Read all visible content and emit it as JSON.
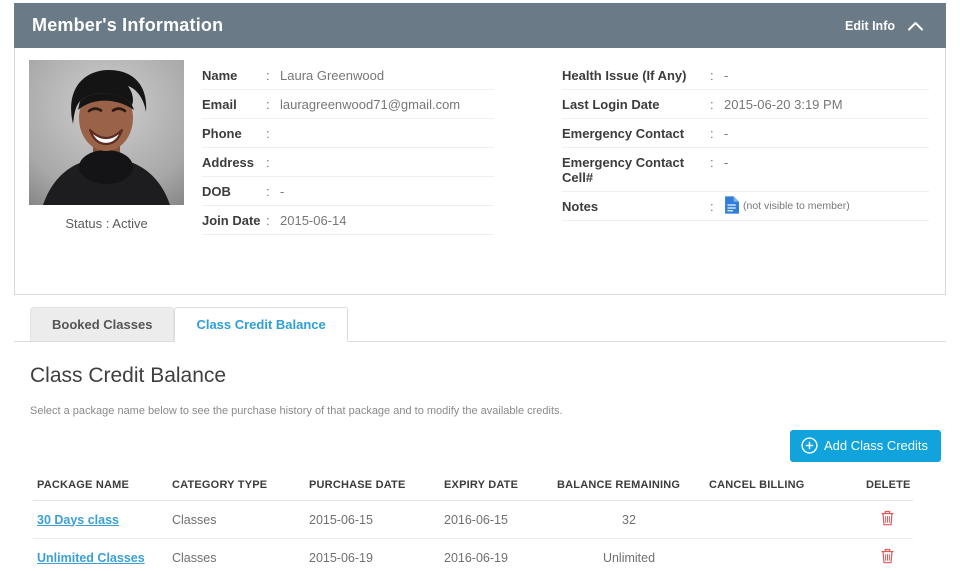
{
  "ui": {
    "colon": ":"
  },
  "colors": {
    "header_bg": "#6a7a86",
    "accent_blue": "#10a3dc",
    "link_blue": "#3b9fd6",
    "tab_active_text": "#2e9fd8",
    "trash_red": "#d95c5c",
    "notes_icon_blue": "#2f7ed8"
  },
  "header": {
    "title": "Member's Information",
    "edit_label": "Edit Info",
    "collapse_icon": "chevron-up-icon"
  },
  "member": {
    "photo_alt": "member-photo",
    "status_text": "Status : Active",
    "details_left": [
      {
        "label": "Name",
        "value": "Laura Greenwood"
      },
      {
        "label": "Email",
        "value": "lauragreenwood71@gmail.com"
      },
      {
        "label": "Phone",
        "value": ""
      },
      {
        "label": "Address",
        "value": ""
      },
      {
        "label": "DOB",
        "value": "-"
      },
      {
        "label": "Join Date",
        "value": "2015-06-14"
      }
    ],
    "details_right": [
      {
        "label": "Health Issue (If Any)",
        "value": "-"
      },
      {
        "label": "Last Login Date",
        "value": "2015-06-20 3:19 PM"
      },
      {
        "label": "Emergency Contact",
        "value": "-"
      },
      {
        "label": "Emergency Contact Cell#",
        "value": "-"
      },
      {
        "label": "Notes",
        "value": "",
        "icon": "document-icon",
        "note": "(not visible to member)"
      }
    ]
  },
  "tabs": [
    {
      "label": "Booked Classes",
      "active": false
    },
    {
      "label": "Class Credit Balance",
      "active": true
    }
  ],
  "section": {
    "title": "Class Credit Balance",
    "description": "Select a package name below to see the purchase history of that package and to modify the available credits.",
    "add_button_label": "Add Class Credits",
    "add_button_icon": "plus-circle-icon"
  },
  "table": {
    "columns": [
      "PACKAGE NAME",
      "CATEGORY TYPE",
      "PURCHASE DATE",
      "EXPIRY DATE",
      "BALANCE REMAINING",
      "CANCEL BILLING",
      "DELETE"
    ],
    "rows": [
      {
        "package_name": "30 Days class",
        "category_type": "Classes",
        "purchase_date": "2015-06-15",
        "expiry_date": "2016-06-15",
        "balance_remaining": "32",
        "cancel_billing": "",
        "delete_icon": "trash-icon"
      },
      {
        "package_name": "Unlimited Classes",
        "category_type": "Classes",
        "purchase_date": "2015-06-19",
        "expiry_date": "2016-06-19",
        "balance_remaining": "Unlimited",
        "cancel_billing": "",
        "delete_icon": "trash-icon"
      }
    ]
  }
}
